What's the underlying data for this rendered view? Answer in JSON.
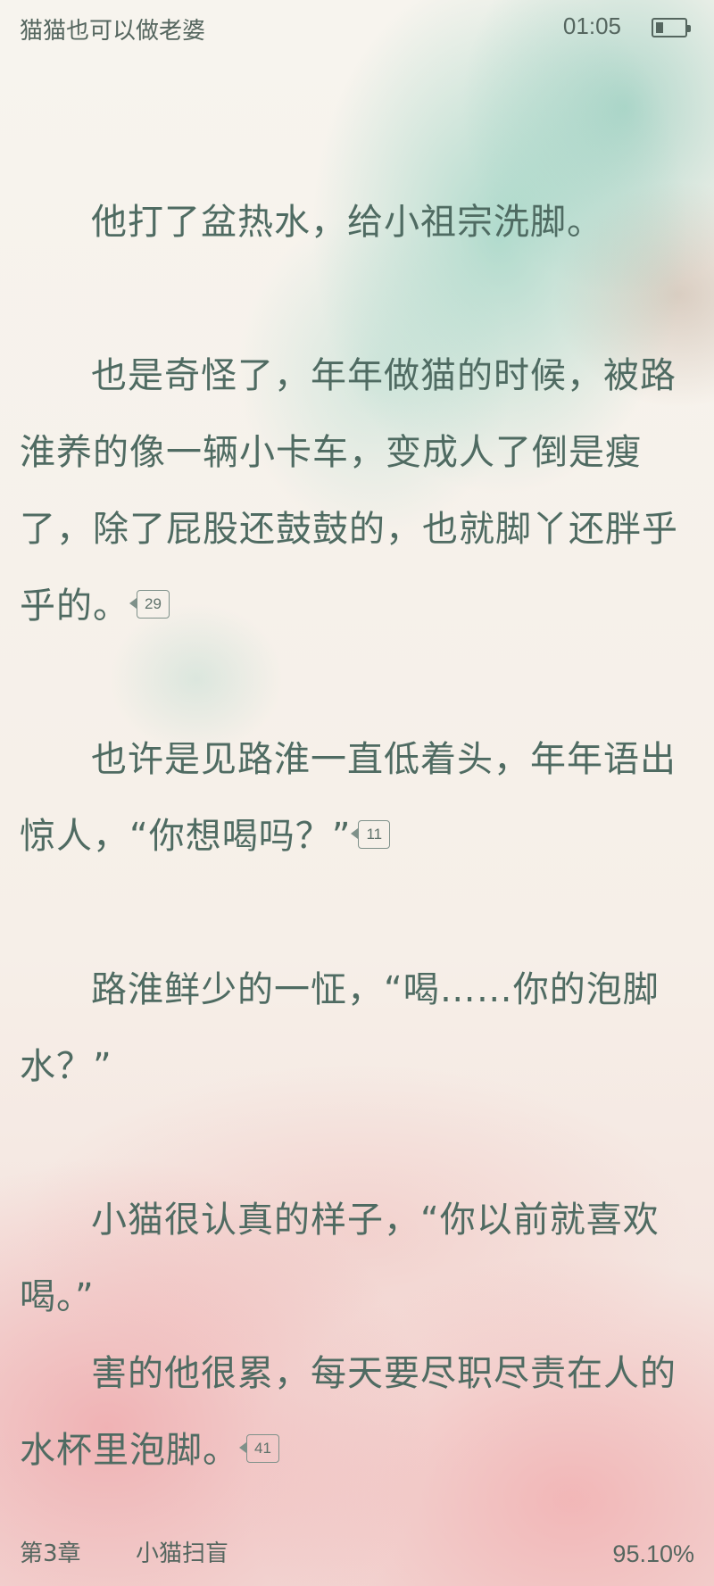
{
  "status_bar": {
    "book_title": "猫猫也可以做老婆",
    "time": "01:05",
    "battery_icon": "battery-low-icon"
  },
  "content": {
    "paragraphs": [
      {
        "text": "他打了盆热水，给小祖宗洗脚。",
        "comments": ""
      },
      {
        "text": "也是奇怪了，年年做猫的时候，被路淮养的像一辆小卡车，变成人了倒是瘦了，除了屁股还鼓鼓的，也就脚丫还胖乎乎的。",
        "comments": "29"
      },
      {
        "text": "也许是见路淮一直低着头，年年语出惊人，“你想喝吗？”",
        "comments": "11"
      },
      {
        "text": "路淮鲜少的一怔，“喝……你的泡脚水？”",
        "comments": ""
      },
      {
        "text": "小猫很认真的样子，“你以前就喜欢喝。”",
        "comments": ""
      },
      {
        "text": "害的他很累，每天要尽职尽责在人的水杯里泡脚。",
        "comments": "41"
      }
    ]
  },
  "footer": {
    "chapter_number": "第3章",
    "chapter_title": "小猫扫盲",
    "progress": "95.10%"
  },
  "colors": {
    "text": "#4f6b62",
    "meta_text": "#55665f",
    "badge_border": "#7f918a"
  }
}
